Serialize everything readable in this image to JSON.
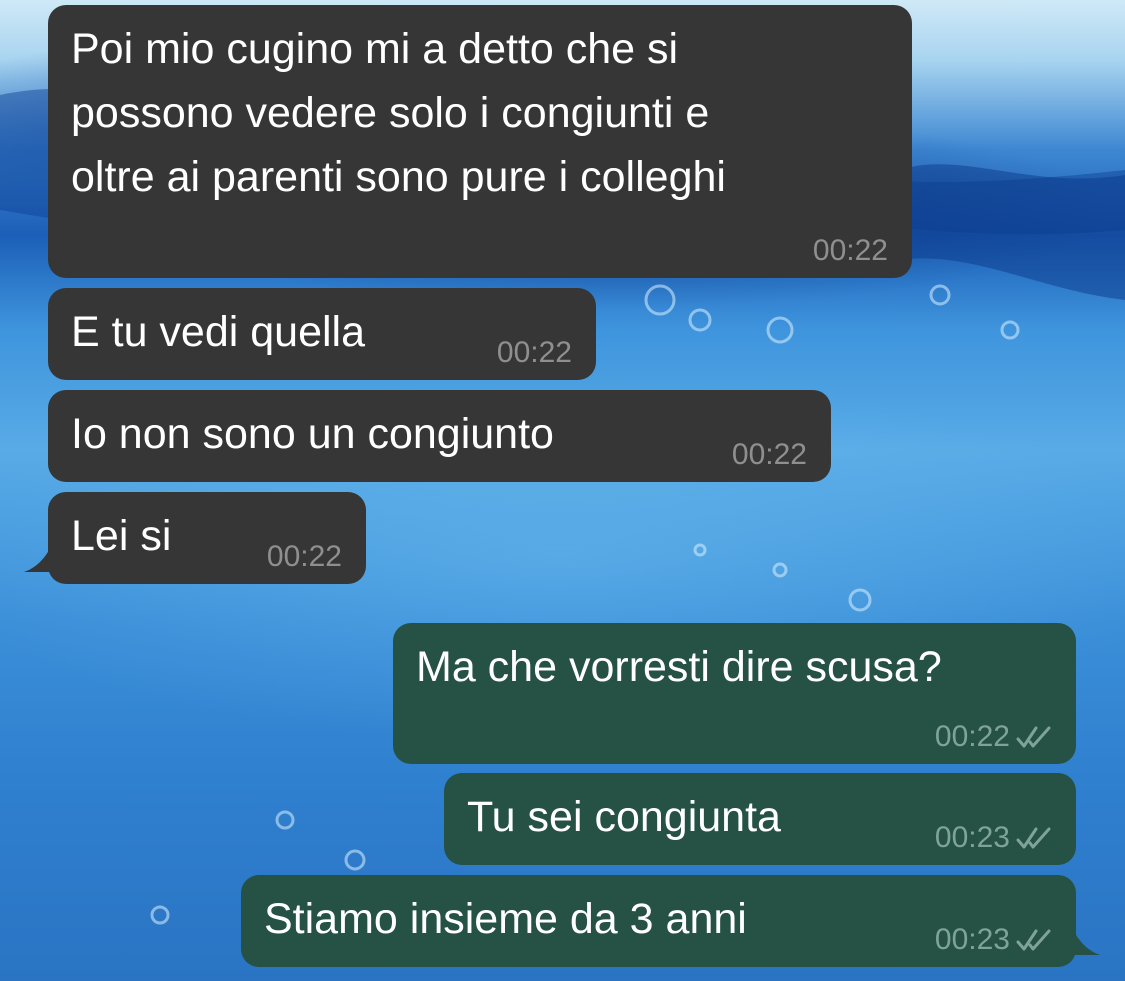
{
  "chat": {
    "messages": [
      {
        "direction": "incoming",
        "text": "Poi mio cugino mi a detto che si\npossono vedere solo i congiunti e\noltre ai parenti sono pure i colleghi",
        "time": "00:22"
      },
      {
        "direction": "incoming",
        "text": "E tu vedi quella",
        "time": "00:22"
      },
      {
        "direction": "incoming",
        "text": "Io non sono un congiunto",
        "time": "00:22"
      },
      {
        "direction": "incoming",
        "text": "Lei si",
        "time": "00:22"
      },
      {
        "direction": "outgoing",
        "text": "Ma che vorresti dire scusa?",
        "time": "00:22",
        "status_icon": "double-check-icon"
      },
      {
        "direction": "outgoing",
        "text": "Tu sei congiunta",
        "time": "00:23",
        "status_icon": "double-check-icon"
      },
      {
        "direction": "outgoing",
        "text": "Stiamo insieme da 3 anni",
        "time": "00:23",
        "status_icon": "double-check-icon"
      }
    ]
  },
  "colors": {
    "incoming_bubble": "#363636",
    "outgoing_bubble": "#255244",
    "timestamp": "#8f8f8f",
    "wallpaper": "#3b8fd8"
  }
}
